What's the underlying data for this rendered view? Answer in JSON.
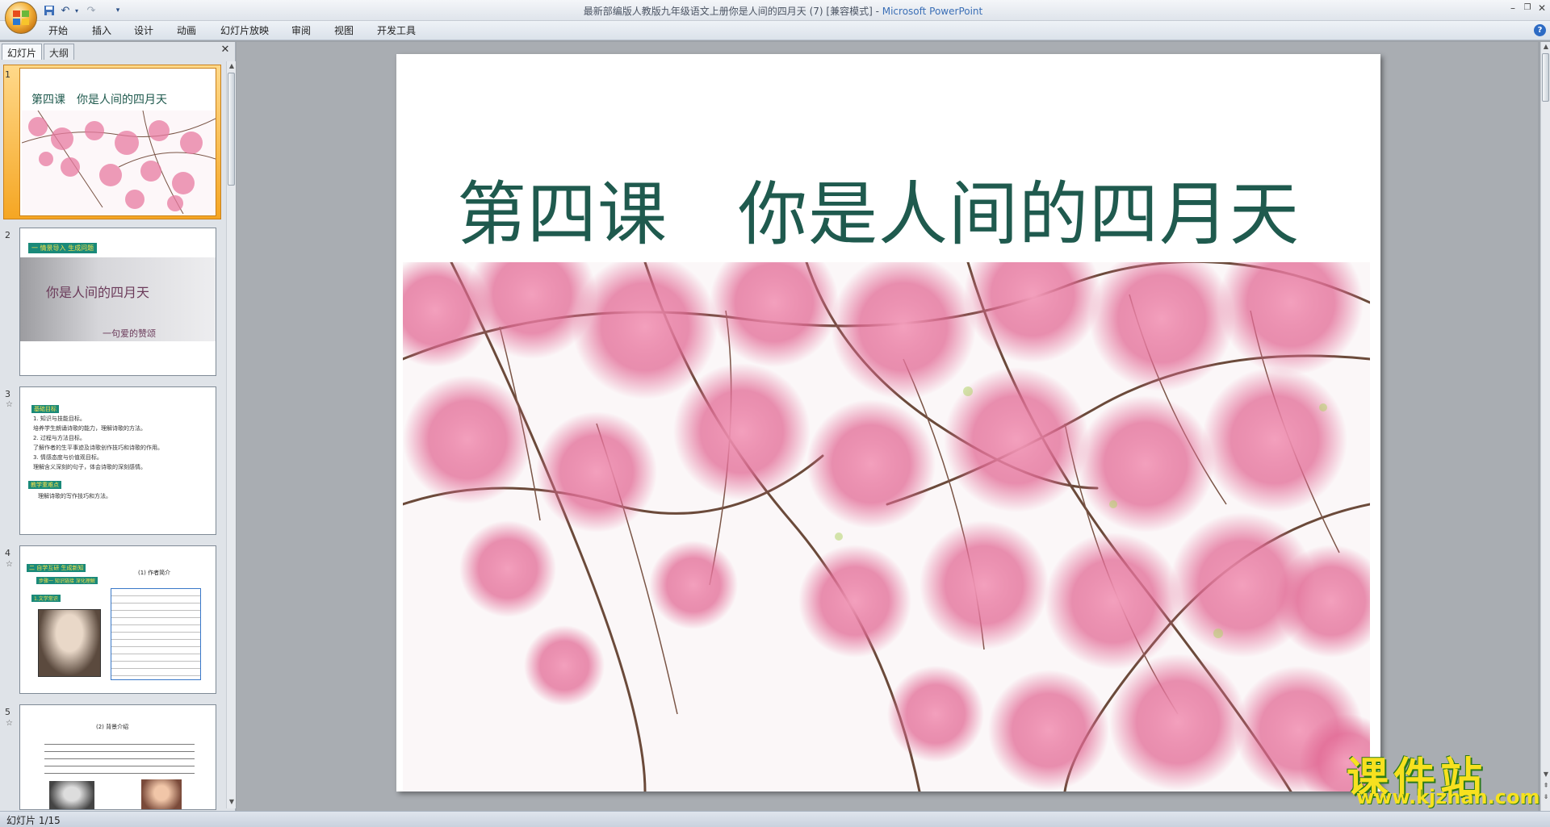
{
  "window": {
    "title": "最新部编版人教版九年级语文上册你是人间的四月天 (7) [兼容模式]",
    "app_name": "Microsoft PowerPoint",
    "separator": " - "
  },
  "menu": [
    "开始",
    "插入",
    "设计",
    "动画",
    "幻灯片放映",
    "审阅",
    "视图",
    "开发工具"
  ],
  "panel": {
    "tabs": [
      "幻灯片",
      "大纲"
    ]
  },
  "thumbnails": [
    {
      "num": "1",
      "title": "第四课　你是人间的四月天"
    },
    {
      "num": "2",
      "tag": "一 情景导入 生成问题",
      "title": "你是人间的四月天",
      "subtitle": "一句爱的赞颂"
    },
    {
      "num": "3",
      "tag1": "基础目标",
      "lines": [
        "1. 知识与技能目标。",
        "培养学生朗诵诗歌的能力，理解诗歌的方法。",
        "2. 过程与方法目标。",
        "了解作者的生平事迹及诗歌创作技巧和诗歌的作用。",
        "3. 情感态度与价值观目标。",
        "理解含义深刻的句子，体会诗歌的深刻感情。"
      ],
      "tag2": "教学重难点",
      "line2": "理解诗歌的写作技巧和方法。"
    },
    {
      "num": "4",
      "tag": "二 自学互研 生成新知",
      "sub": "步骤一 知识链接 深化理解",
      "sub2": "1.文学常识",
      "caption": "(1) 作者简介"
    },
    {
      "num": "5",
      "caption": "(2) 背景介绍"
    }
  ],
  "slide": {
    "title": "第四课　你是人间的四月天"
  },
  "status": {
    "text": "幻灯片 1/15"
  },
  "watermark": {
    "cn": "课件站",
    "url": "www.kjzhan.com"
  },
  "colors": {
    "title_green": "#1f5a4e",
    "blossom_pink": "#e8719a",
    "branch": "#6b4a3a",
    "selection": "#f5a623"
  }
}
